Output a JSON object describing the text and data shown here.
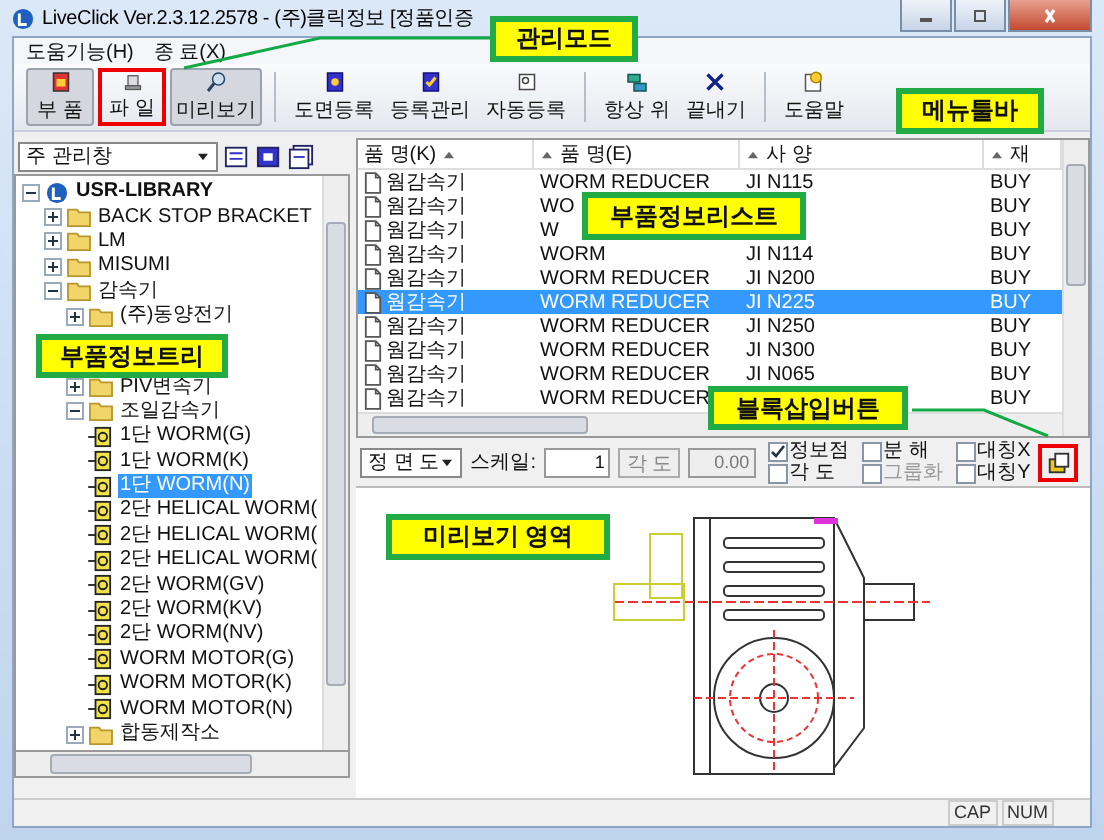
{
  "window": {
    "title": "LiveClick Ver.2.3.12.2578 - (주)클릭정보 [정품인증"
  },
  "menu": [
    "도움기능(H)",
    "종 료(X)"
  ],
  "toolbar": [
    {
      "kind": "part",
      "label": "부 품",
      "pressed": true
    },
    {
      "kind": "file",
      "label": "파 일",
      "pressed": false,
      "highlight": true
    },
    {
      "kind": "preview",
      "label": "미리보기",
      "pressed": true
    },
    {
      "kind": "separator"
    },
    {
      "kind": "drawing",
      "label": "도면등록",
      "pressed": false
    },
    {
      "kind": "manage",
      "label": "등록관리",
      "pressed": false
    },
    {
      "kind": "auto",
      "label": "자동등록",
      "pressed": false
    },
    {
      "kind": "separator"
    },
    {
      "kind": "ontop",
      "label": "항상 위",
      "pressed": false
    },
    {
      "kind": "exit",
      "label": "끝내기",
      "pressed": false
    },
    {
      "kind": "separator"
    },
    {
      "kind": "help",
      "label": "도움말",
      "pressed": false
    }
  ],
  "view_select": {
    "value": "주 관리창"
  },
  "tree": {
    "label": "USR-LIBRARY",
    "kind": "root",
    "expanded": true,
    "selected": false,
    "children": [
      {
        "label": "BACK STOP BRACKET",
        "kind": "folder",
        "expanded": false,
        "selected": false
      },
      {
        "label": "LM",
        "kind": "folder",
        "expanded": false,
        "selected": false
      },
      {
        "label": "MISUMI",
        "kind": "folder",
        "expanded": false,
        "selected": false
      },
      {
        "label": "감속기",
        "kind": "folder",
        "expanded": true,
        "selected": false,
        "children": [
          {
            "label": "(주)동양전기",
            "kind": "folder",
            "expanded": false,
            "selected": false
          },
          {
            "label": "PIV변속기",
            "kind": "folder",
            "expanded": false,
            "selected": false
          },
          {
            "label": "조일감속기",
            "kind": "folder",
            "expanded": true,
            "selected": false,
            "children": [
              {
                "label": "1단 WORM(G)",
                "kind": "part",
                "selected": false
              },
              {
                "label": "1단 WORM(K)",
                "kind": "part",
                "selected": false
              },
              {
                "label": "1단 WORM(N)",
                "kind": "part",
                "selected": true
              },
              {
                "label": "2단 HELICAL WORM(",
                "kind": "part",
                "selected": false
              },
              {
                "label": "2단 HELICAL WORM(",
                "kind": "part",
                "selected": false
              },
              {
                "label": "2단 HELICAL WORM(",
                "kind": "part",
                "selected": false
              },
              {
                "label": "2단 WORM(GV)",
                "kind": "part",
                "selected": false
              },
              {
                "label": "2단 WORM(KV)",
                "kind": "part",
                "selected": false
              },
              {
                "label": "2단 WORM(NV)",
                "kind": "part",
                "selected": false
              },
              {
                "label": "WORM MOTOR(G)",
                "kind": "part",
                "selected": false
              },
              {
                "label": "WORM MOTOR(K)",
                "kind": "part",
                "selected": false
              },
              {
                "label": "WORM MOTOR(N)",
                "kind": "part",
                "selected": false
              }
            ]
          },
          {
            "label": "합동제작소",
            "kind": "folder",
            "expanded": false,
            "selected": false
          }
        ]
      }
    ]
  },
  "list": {
    "columns": [
      "품  명(K)",
      "품  명(E)",
      "사  양",
      "재"
    ],
    "rows": [
      {
        "name_k": "웜감속기",
        "name_e": "WORM REDUCER",
        "spec": "JI N115",
        "material": "BUY",
        "selected": false
      },
      {
        "name_k": "웜감속기",
        "name_e": "WO",
        "material": "BUY",
        "selected": false
      },
      {
        "name_k": "웜감속기",
        "name_e": "W",
        "material": "BUY",
        "selected": false
      },
      {
        "name_k": "웜감속기",
        "name_e": "WORM",
        "spec": "JI N114",
        "material": "BUY",
        "selected": false
      },
      {
        "name_k": "웜감속기",
        "name_e": "WORM REDUCER",
        "spec": "JI N200",
        "material": "BUY",
        "selected": false
      },
      {
        "name_k": "웜감속기",
        "name_e": "WORM REDUCER",
        "spec": "JI N225",
        "material": "BUY",
        "selected": true
      },
      {
        "name_k": "웜감속기",
        "name_e": "WORM REDUCER",
        "spec": "JI N250",
        "material": "BUY",
        "selected": false
      },
      {
        "name_k": "웜감속기",
        "name_e": "WORM REDUCER",
        "spec": "JI N300",
        "material": "BUY",
        "selected": false
      },
      {
        "name_k": "웜감속기",
        "name_e": "WORM REDUCER",
        "spec": "JI N065",
        "material": "BUY",
        "selected": false
      },
      {
        "name_k": "웜감속기",
        "name_e": "WORM REDUCER",
        "material": "BUY",
        "selected": false
      }
    ]
  },
  "options": {
    "view": "정 면 도",
    "scale_label": "스케일:",
    "scale": "1",
    "angle_button": "각 도",
    "angle": "0.00",
    "checks": [
      {
        "label": "정보점",
        "checked": true,
        "disabled": false
      },
      {
        "label": "각  도",
        "checked": false,
        "disabled": false
      },
      {
        "label": "분  해",
        "checked": false,
        "disabled": false
      },
      {
        "label": "그룹화",
        "checked": false,
        "disabled": true
      },
      {
        "label": "대칭X",
        "checked": false,
        "disabled": false
      },
      {
        "label": "대칭Y",
        "checked": false,
        "disabled": false
      }
    ],
    "block_button": {
      "highlight": true
    }
  },
  "status_bar": [
    "CAP",
    "NUM"
  ],
  "callouts": [
    "관리모드",
    "메뉴툴바",
    "부품정보트리",
    "부품정보리스트",
    "블록삽입버튼",
    "미리보기 영역"
  ]
}
